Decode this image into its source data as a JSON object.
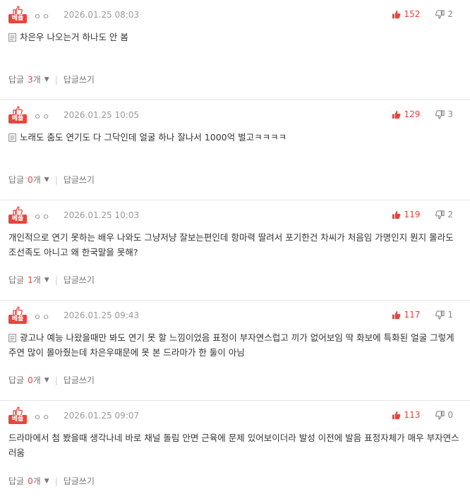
{
  "best_label": "베플",
  "reply_label": "답글",
  "count_unit": "개",
  "write_reply_label": "답글쓰기",
  "comments": [
    {
      "author": "ㅇㅇ",
      "date": "2026.01.25 08:03",
      "up": "152",
      "down": "2",
      "has_icon": true,
      "text": "차은우 나오는거 하나도 안 봄",
      "reply_count": "3"
    },
    {
      "author": "ㅇㅇ",
      "date": "2026.01.25 10:05",
      "up": "129",
      "down": "3",
      "has_icon": true,
      "text": "노래도 춤도 연기도 다 그닥인데 얼굴 하나 잘나서 1000억 벌고ㅋㅋㅋㅋ",
      "reply_count": "0"
    },
    {
      "author": "ㅇㅇ",
      "date": "2026.01.25 10:03",
      "up": "119",
      "down": "2",
      "has_icon": false,
      "text": "개인적으로 연기 못하는 배우 나와도 그냥저냥 잘보는편인데 항마력 딸려서 포기한건 차씨가 처음임 가명인지 뭔지 몰라도 조선족도 아니고 왜 한국말을 못해?",
      "reply_count": "1"
    },
    {
      "author": "ㅇㅇ",
      "date": "2026.01.25 09:43",
      "up": "117",
      "down": "1",
      "has_icon": true,
      "text": "광고나 예능 나왔을때만 봐도 연기 못 할 느낌이었음 표정이 부자연스럽고 끼가 없어보임 딱 화보에 특화된 얼굴 그렇게 주연 많이 몰아줬는데 차은우때문에 못 본 드라마가 한 둘이 아님",
      "reply_count": "0"
    },
    {
      "author": "ㅇㅇ",
      "date": "2026.01.25 09:07",
      "up": "113",
      "down": "0",
      "has_icon": false,
      "text": "드라마에서 첨 봤을때 생각나네 바로 채널 돌림 안면 근육에 문제 있어보이더라 발성 이전에 발음 표정자체가 매우 부자연스러움",
      "reply_count": "0"
    }
  ],
  "colors": {
    "accent": "#e0463f",
    "badge": "#e8453c",
    "muted": "#9a9a9a"
  }
}
